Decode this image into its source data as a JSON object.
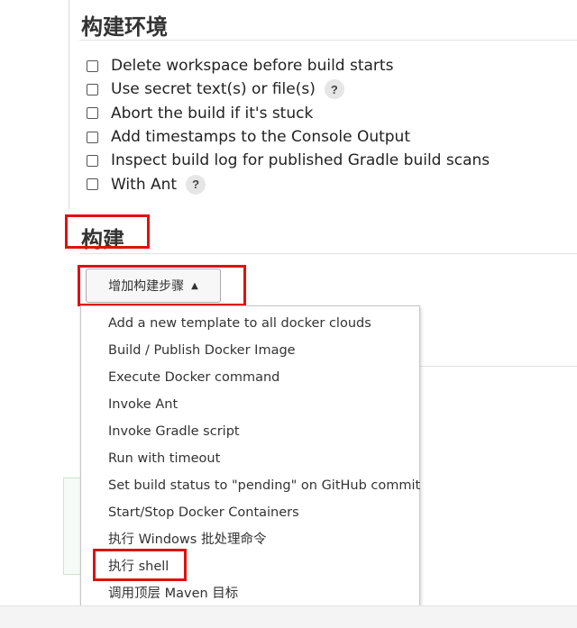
{
  "build_environment": {
    "title": "构建环境",
    "options": [
      {
        "label": "Delete workspace before build starts",
        "checked": false,
        "help": ""
      },
      {
        "label": "Use secret text(s) or file(s)",
        "checked": false,
        "help": "?"
      },
      {
        "label": "Abort the build if it's stuck",
        "checked": false,
        "help": ""
      },
      {
        "label": "Add timestamps to the Console Output",
        "checked": false,
        "help": ""
      },
      {
        "label": "Inspect build log for published Gradle build scans",
        "checked": false,
        "help": ""
      },
      {
        "label": "With Ant",
        "checked": false,
        "help": "?"
      }
    ]
  },
  "build": {
    "title": "构建",
    "add_step_button": {
      "label": "增加构建步骤",
      "caret": "▲"
    }
  },
  "dropdown": {
    "items": [
      "Add a new template to all docker clouds",
      "Build / Publish Docker Image",
      "Execute Docker command",
      "Invoke Ant",
      "Invoke Gradle script",
      "Run with timeout",
      "Set build status to \"pending\" on GitHub commit",
      "Start/Stop Docker Containers",
      "执行 Windows 批处理命令",
      "执行 shell",
      "调用顶层 Maven 目标"
    ]
  },
  "colors": {
    "highlight_box": "#e01010"
  }
}
